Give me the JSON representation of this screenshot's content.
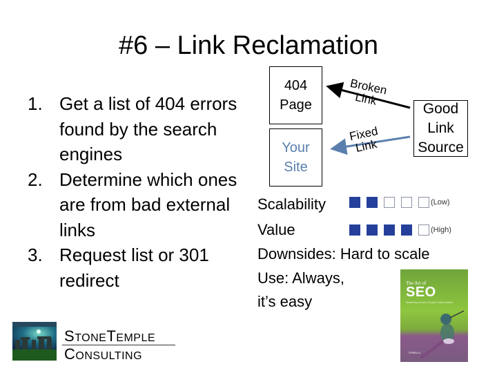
{
  "slide": {
    "title": "#6 – Link Reclamation",
    "steps": [
      {
        "num": "1.",
        "text": "Get a list of 404 errors found by the search engines"
      },
      {
        "num": "2.",
        "text": "Determine which ones are from bad external links"
      },
      {
        "num": "3.",
        "text": "Request list or 301 redirect"
      }
    ]
  },
  "diagram": {
    "box_404": {
      "line1": "404",
      "line2": "Page"
    },
    "box_site": {
      "line1": "Your",
      "line2": "Site"
    },
    "box_good": {
      "line1": "Good",
      "line2": "Link",
      "line3": "Source"
    },
    "arrow_broken": {
      "line1": "Broken",
      "line2": "Link",
      "color": "#000000"
    },
    "arrow_fixed": {
      "line1": "Fixed",
      "line2": "Link",
      "color": "#5a7fae"
    }
  },
  "ratings": {
    "scalability": {
      "label": "Scalability",
      "filled": 2,
      "total": 5,
      "tag": "(Low)"
    },
    "value": {
      "label": "Value",
      "filled": 4,
      "total": 5,
      "tag": "(High)"
    },
    "fill_color": "#25409a"
  },
  "notes": {
    "downsides": "Downsides: Hard to scale",
    "use_line1": "Use: Always,",
    "use_line2": "it’s easy"
  },
  "book": {
    "sub": "The Art of",
    "title": "SEO",
    "tagline": "Mastering Search Engine Optimization",
    "publisher": "O'REILLY"
  },
  "logo": {
    "line1_caps": [
      "S",
      "TONE",
      "T",
      "EMPLE"
    ],
    "line2_caps": [
      "C",
      "ONSULTING"
    ]
  }
}
